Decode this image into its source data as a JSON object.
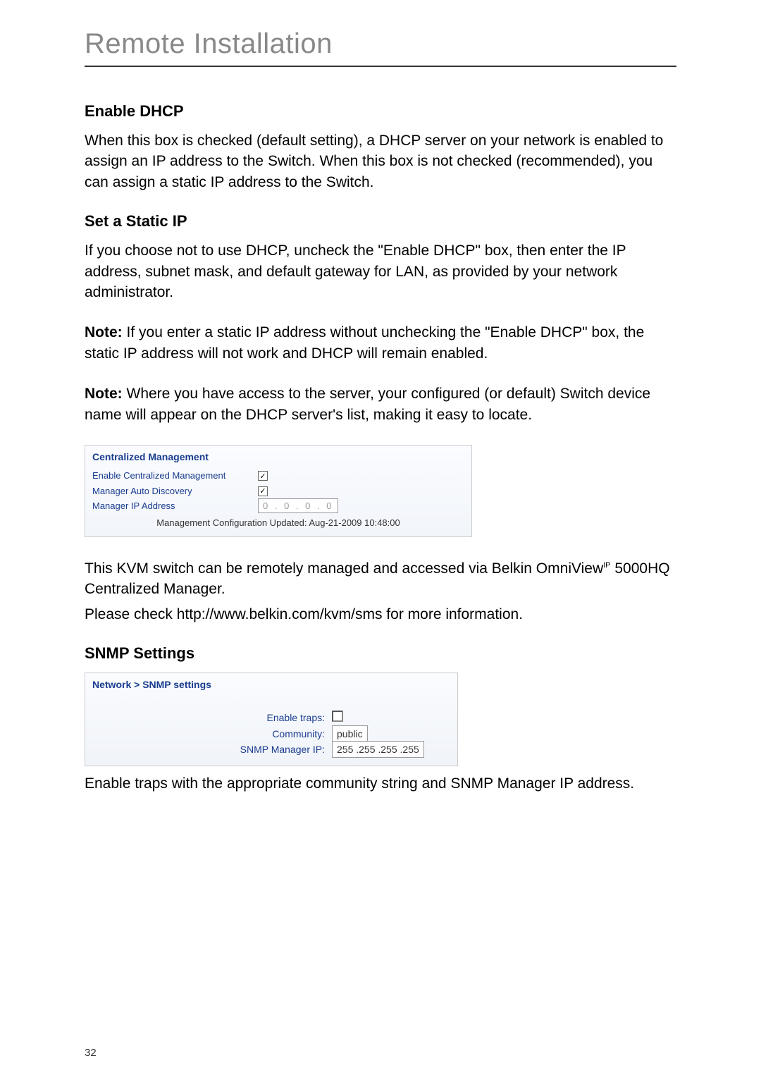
{
  "page": {
    "title": "Remote Installation",
    "number": "32"
  },
  "sections": {
    "enable_dhcp": {
      "heading": "Enable DHCP",
      "body": "When this box is checked (default setting), a DHCP server on your network is enabled to assign an IP address to the Switch. When this box is not checked (recommended), you can assign a static IP address to the Switch."
    },
    "static_ip": {
      "heading": "Set a Static IP",
      "body": "If you choose not to use DHCP, uncheck the \"Enable DHCP\" box, then enter the IP address, subnet mask, and default gateway for LAN, as provided by your network administrator.",
      "note1_label": "Note:",
      "note1": " If you enter a static IP address without unchecking the \"Enable DHCP\" box, the static IP address will not work and DHCP will remain enabled.",
      "note2_label": "Note:",
      "note2": " Where you have access to the server, your configured (or default) Switch device name will appear on the DHCP server's list, making it easy to locate."
    },
    "centralized": {
      "title": "Centralized Management",
      "rows": {
        "enable_label": "Enable Centralized Management",
        "auto_label": "Manager Auto Discovery",
        "ip_label": "Manager IP Address",
        "ip_value": "0 . 0 . 0 . 0"
      },
      "footer": "Management Configuration Updated: Aug-21-2009 10:48:00"
    },
    "kvm": {
      "body1a": "This KVM switch can be remotely managed and accessed via Belkin OmniView",
      "body1sup": "IP",
      "body1b": " 5000HQ Centralized Manager.",
      "body2": "Please check http://www.belkin.com/kvm/sms for more information."
    },
    "snmp": {
      "heading": "SNMP Settings",
      "panel_title": "Network > SNMP settings",
      "rows": {
        "traps_label": "Enable traps:",
        "community_label": "Community:",
        "community_value": "public",
        "manager_label": "SNMP Manager IP:",
        "manager_value": "255 .255 .255 .255"
      },
      "footer": "Enable traps with the appropriate community string and SNMP Manager IP address."
    }
  }
}
